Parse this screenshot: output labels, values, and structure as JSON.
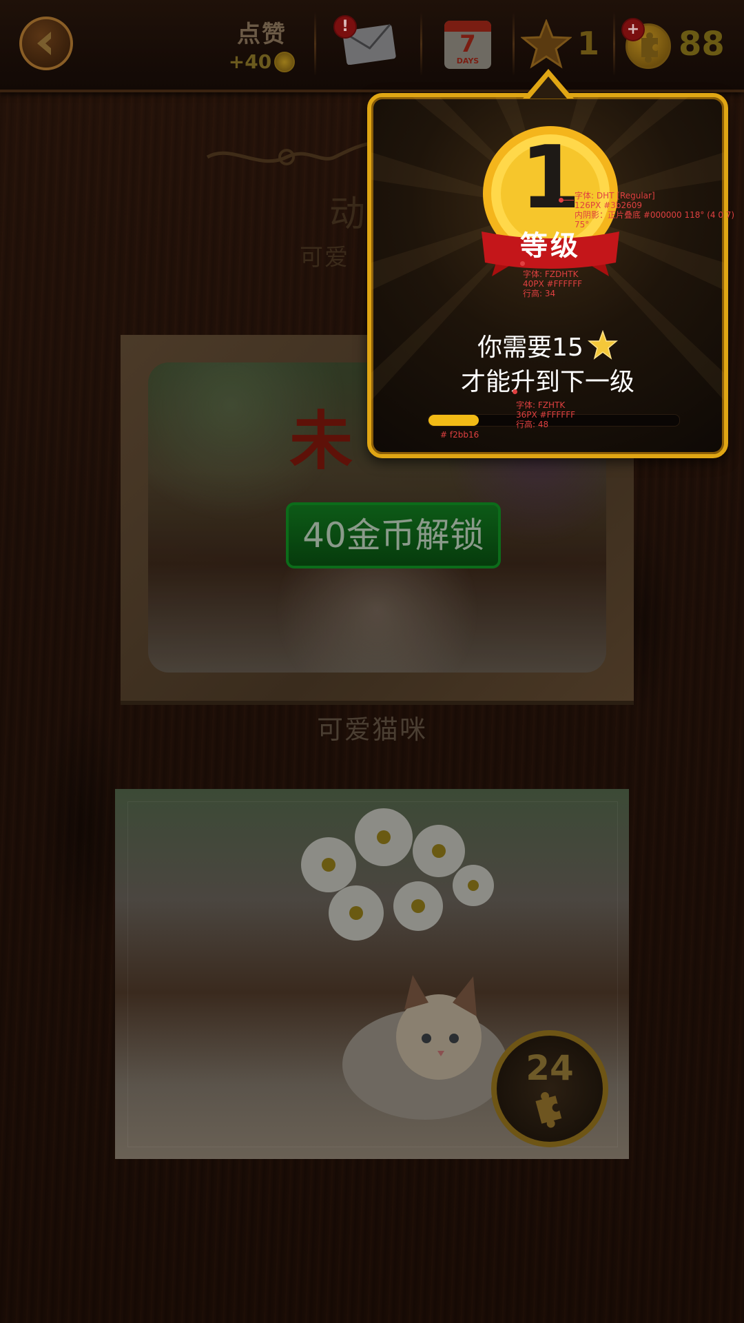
{
  "header": {
    "like_title": "点赞",
    "like_reward": "+40",
    "mail_badge": "!",
    "calendar_number": "7",
    "calendar_label": "DAYS",
    "star_count": "1",
    "coin_plus": "+",
    "coin_count": "88"
  },
  "section": {
    "title": "动",
    "subtitle": "可爱"
  },
  "locked_card": {
    "status_text": "未",
    "unlock_button": "40金币解锁",
    "caption": "可爱猫咪"
  },
  "unlocked_card": {
    "piece_count": "24"
  },
  "level_popup": {
    "level_number": "1",
    "level_label": "等级",
    "need_text": "你需要15",
    "next_text": "才能升到下一级",
    "progress_fraction": 0.2,
    "progress_color": "#f2bb16",
    "annotations": {
      "number_font": "字体: DHT [Regular]",
      "number_size": "126PX #3b2609",
      "number_shadow": "内阴影：正片叠底 #000000  118° (4  0  7)",
      "number_extra": "75°",
      "label_font": "字体: FZDHTK",
      "label_size": "40PX #FFFFFF",
      "label_line_height": "行高: 34",
      "text_font": "字体: FZHTK",
      "text_size": "36PX #FFFFFF",
      "text_line_height": "行高: 48",
      "progress_color_note": "# f2bb16"
    }
  },
  "colors": {
    "popup_border": "#e0a614",
    "progress_fill": "#f2bb16",
    "unlock_button": "#0d5a17"
  }
}
